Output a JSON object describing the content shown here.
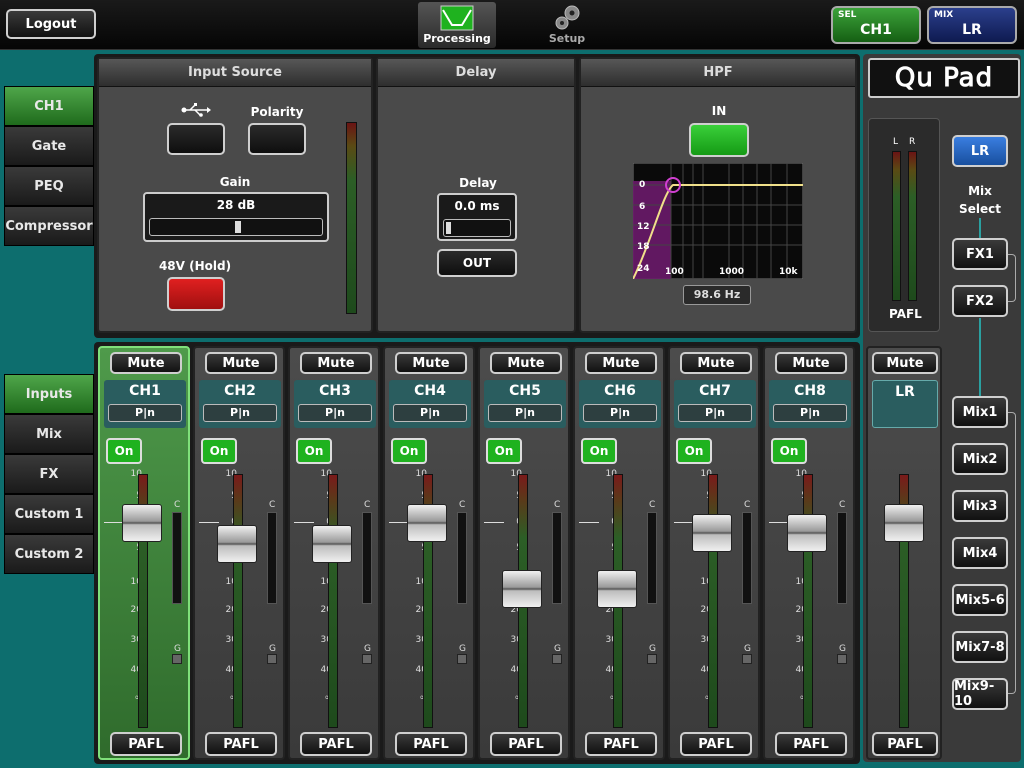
{
  "topbar": {
    "logout": "Logout",
    "tabs": [
      {
        "label": "Processing",
        "icon": "processing-icon"
      },
      {
        "label": "Setup",
        "icon": "gears-icon"
      }
    ],
    "sel": {
      "label": "SEL",
      "value": "CH1"
    },
    "mix": {
      "label": "MIX",
      "value": "LR"
    }
  },
  "left_nav_top": [
    "CH1",
    "Gate",
    "PEQ",
    "Compressor"
  ],
  "left_nav_bottom": [
    "Inputs",
    "Mix",
    "FX",
    "Custom 1",
    "Custom 2"
  ],
  "input_source": {
    "title": "Input Source",
    "usb_icon": "usb-icon",
    "polarity": "Polarity",
    "gain_label": "Gain",
    "gain_value": "28 dB",
    "phantom": "48V (Hold)"
  },
  "delay": {
    "title": "Delay",
    "label": "Delay",
    "value": "0.0 ms",
    "out": "OUT"
  },
  "hpf": {
    "title": "HPF",
    "in": "IN",
    "freq": "98.6 Hz",
    "y_ticks": [
      "0",
      "6",
      "12",
      "18",
      "24"
    ],
    "x_ticks": [
      "100",
      "1000",
      "10k"
    ]
  },
  "brand": "Qu Pad",
  "master_meter": {
    "l": "L",
    "r": "R",
    "pafl": "PAFL"
  },
  "mix_select": {
    "label_1": "Mix",
    "label_2": "Select",
    "lr": "LR",
    "fx": [
      "FX1",
      "FX2"
    ],
    "mixes": [
      "Mix1",
      "Mix2",
      "Mix3",
      "Mix4",
      "Mix5-6",
      "Mix7-8",
      "Mix9-10"
    ]
  },
  "fader_scale": [
    "10",
    "5",
    "0",
    "5",
    "10",
    "20",
    "30",
    "40",
    "∞"
  ],
  "fader_scale_labels": {
    "c": "C",
    "g": "G"
  },
  "channels": [
    {
      "name": "CH1",
      "mute": "Mute",
      "pan": "P|n",
      "on": "On",
      "pafl": "PAFL",
      "fader_db": 0
    },
    {
      "name": "CH2",
      "mute": "Mute",
      "pan": "P|n",
      "on": "On",
      "pafl": "PAFL",
      "fader_db": -4
    },
    {
      "name": "CH3",
      "mute": "Mute",
      "pan": "P|n",
      "on": "On",
      "pafl": "PAFL",
      "fader_db": -4
    },
    {
      "name": "CH4",
      "mute": "Mute",
      "pan": "P|n",
      "on": "On",
      "pafl": "PAFL",
      "fader_db": 0
    },
    {
      "name": "CH5",
      "mute": "Mute",
      "pan": "P|n",
      "on": "On",
      "pafl": "PAFL",
      "fader_db": -12
    },
    {
      "name": "CH6",
      "mute": "Mute",
      "pan": "P|n",
      "on": "On",
      "pafl": "PAFL",
      "fader_db": -12
    },
    {
      "name": "CH7",
      "mute": "Mute",
      "pan": "P|n",
      "on": "On",
      "pafl": "PAFL",
      "fader_db": -2
    },
    {
      "name": "CH8",
      "mute": "Mute",
      "pan": "P|n",
      "on": "On",
      "pafl": "PAFL",
      "fader_db": -2
    }
  ],
  "master": {
    "name": "LR",
    "mute": "Mute",
    "pafl": "PAFL",
    "fader_db": 0
  },
  "colors": {
    "accent_green": "#1fb21f",
    "teal_bg": "#0d6e6e",
    "phantom_red": "#d11a1a",
    "hpf_curve": "#f0e08a",
    "lr_blue": "#1d5fc0"
  }
}
